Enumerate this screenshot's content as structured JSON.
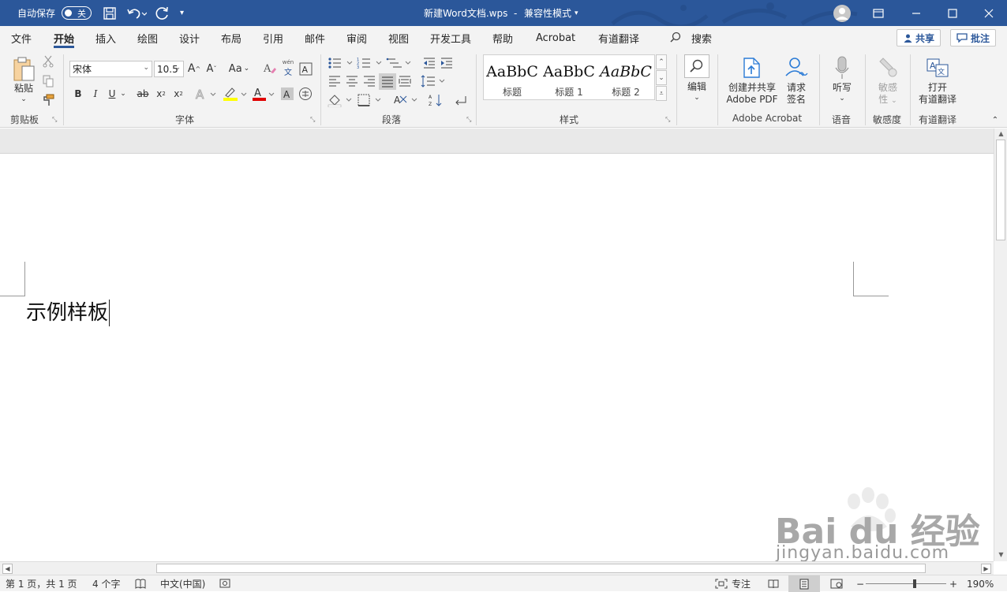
{
  "titlebar": {
    "autosave_label": "自动保存",
    "autosave_state": "关",
    "doc_title": "新建Word文档.wps",
    "separator": "-",
    "mode": "兼容性模式",
    "background_color": "#2b579a"
  },
  "tabs": [
    "文件",
    "开始",
    "插入",
    "绘图",
    "设计",
    "布局",
    "引用",
    "邮件",
    "审阅",
    "视图",
    "开发工具",
    "帮助",
    "Acrobat",
    "有道翻译"
  ],
  "active_tab": "开始",
  "search_label": "搜索",
  "share_label": "共享",
  "comments_label": "批注",
  "ribbon": {
    "clipboard": {
      "paste_label": "粘贴",
      "group_label": "剪贴板"
    },
    "font": {
      "font_name": "宋体",
      "font_size": "10.5",
      "group_label": "字体",
      "grow": "A",
      "shrink": "A",
      "case": "Aa",
      "bold": "B",
      "italic": "I",
      "underline": "U",
      "strike": "ab",
      "sub": "x",
      "sup": "x",
      "phonetic_top": "wén",
      "phonetic_bottom": "文"
    },
    "paragraph": {
      "group_label": "段落"
    },
    "styles": {
      "group_label": "样式",
      "items": [
        {
          "sample": "AaBbC",
          "name": "标题"
        },
        {
          "sample": "AaBbC",
          "name": "标题 1"
        },
        {
          "sample": "AaBbC",
          "name": "标题 2"
        }
      ]
    },
    "editing": {
      "label": "编辑"
    },
    "acrobat": {
      "create_share_line1": "创建并共享",
      "create_share_line2": "Adobe PDF",
      "request_line1": "请求",
      "request_line2": "签名",
      "group_label": "Adobe Acrobat"
    },
    "voice": {
      "dictate_label": "听写",
      "group_label": "语音"
    },
    "sensitivity": {
      "line1": "敏感",
      "line2": "性",
      "group_label": "敏感度"
    },
    "youdao": {
      "line1": "打开",
      "line2": "有道翻译",
      "group_label": "有道翻译"
    }
  },
  "document": {
    "text": "示例样板"
  },
  "statusbar": {
    "page": "第 1 页，共 1 页",
    "words": "4 个字",
    "language": "中文(中国)",
    "focus": "专注",
    "zoom": "190%",
    "zoom_out": "−",
    "zoom_in": "+"
  },
  "watermark": {
    "main": "Bai du 经验",
    "url": "jingyan.baidu.com"
  }
}
